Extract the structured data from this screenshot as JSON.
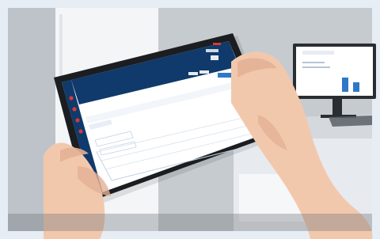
{
  "scene": {
    "description_tags": [
      "photo",
      "hands-holding-tablet",
      "lab-environment"
    ],
    "colors": {
      "frame": "#e6edf5",
      "wall_left": "#d7dde3",
      "wall_right": "#c9cdd1",
      "fridge": "#f2f4f6",
      "desk": "#d8dbdf",
      "skin": "#f2c8ad",
      "skin_shadow": "#e3b094",
      "tablet_bezel": "#1b1d20",
      "ui_header": "#0f3a6b",
      "ui_sidebar": "#0f3a6b",
      "ui_accent": "#2f78c8",
      "ui_bg": "#ffffff",
      "ui_red": "#d63a3a",
      "monitor_bezel": "#2a2d31"
    }
  },
  "tablet_ui": {
    "topbar_dot_labels": [
      "",
      "",
      ""
    ],
    "content_hint": "chart-grid-and-forms"
  },
  "monitor_ui": {
    "content_hint": "dashboard-with-blue-bars"
  }
}
